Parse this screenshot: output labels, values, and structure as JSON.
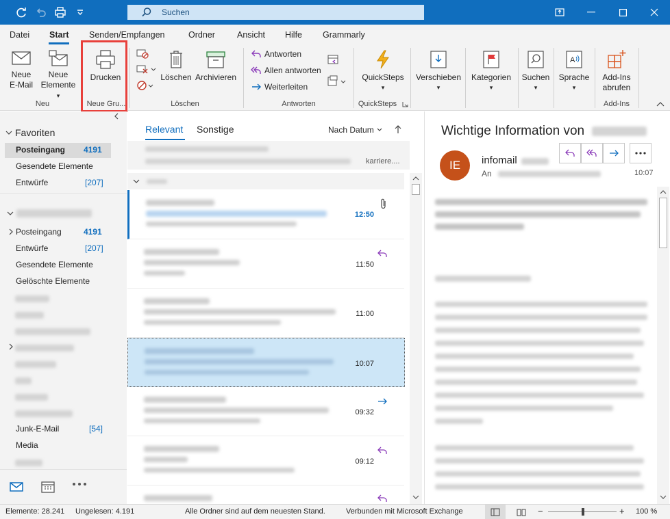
{
  "titlebar": {
    "search_placeholder": "Suchen"
  },
  "menu": {
    "tabs": [
      "Datei",
      "Start",
      "Senden/Empfangen",
      "Ordner",
      "Ansicht",
      "Hilfe",
      "Grammarly"
    ],
    "active": "Start"
  },
  "ribbon": {
    "neue_email": "Neue\nE-Mail",
    "neue_email_l1": "Neue",
    "neue_email_l2": "E-Mail",
    "neue_elemente_l1": "Neue",
    "neue_elemente_l2": "Elemente",
    "group_neu": "Neu",
    "drucken": "Drucken",
    "group_neue_gru": "Neue Gru...",
    "loeschen": "Löschen",
    "archivieren": "Archivieren",
    "group_loeschen": "Löschen",
    "antworten": "Antworten",
    "allen_antworten": "Allen antworten",
    "weiterleiten": "Weiterleiten",
    "group_antworten": "Antworten",
    "quicksteps": "QuickSteps",
    "group_quicksteps": "QuickSteps",
    "verschieben": "Verschieben",
    "kategorien": "Kategorien",
    "suchen": "Suchen",
    "sprache": "Sprache",
    "addins_l1": "Add-Ins",
    "addins_l2": "abrufen",
    "group_addins": "Add-Ins"
  },
  "folders": {
    "favoriten": "Favoriten",
    "fav": [
      {
        "label": "Posteingang",
        "count": "4191"
      },
      {
        "label": "Gesendete Elemente",
        "count": ""
      },
      {
        "label": "Entwürfe",
        "count": "[207]"
      }
    ],
    "account": [
      {
        "label": "Posteingang",
        "count": "4191"
      },
      {
        "label": "Entwürfe",
        "count": "[207]"
      },
      {
        "label": "Gesendete Elemente",
        "count": ""
      },
      {
        "label": "Gelöschte Elemente",
        "count": ""
      }
    ],
    "junk": {
      "label": "Junk-E-Mail",
      "count": "[54]"
    },
    "media": "Media"
  },
  "list": {
    "tab_relevant": "Relevant",
    "tab_sonstige": "Sonstige",
    "sort": "Nach Datum",
    "preview_tail": "karriere....",
    "times": [
      "12:50",
      "11:50",
      "11:00",
      "10:07",
      "09:32",
      "09:12"
    ]
  },
  "reading": {
    "subject": "Wichtige Information von",
    "avatar_initials": "IE",
    "sender": "infomail",
    "to_label": "An",
    "time": "10:07"
  },
  "status": {
    "elemente": "Elemente: 28.241",
    "ungelesen": "Ungelesen: 4.191",
    "ordner": "Alle Ordner sind auf dem neuesten Stand.",
    "verbunden": "Verbunden mit Microsoft Exchange",
    "zoom": "100 %",
    "zoom_level": 1.0
  },
  "colors": {
    "accent": "#106ebe",
    "highlight": "#e8403b",
    "avatar": "#c5511a"
  }
}
